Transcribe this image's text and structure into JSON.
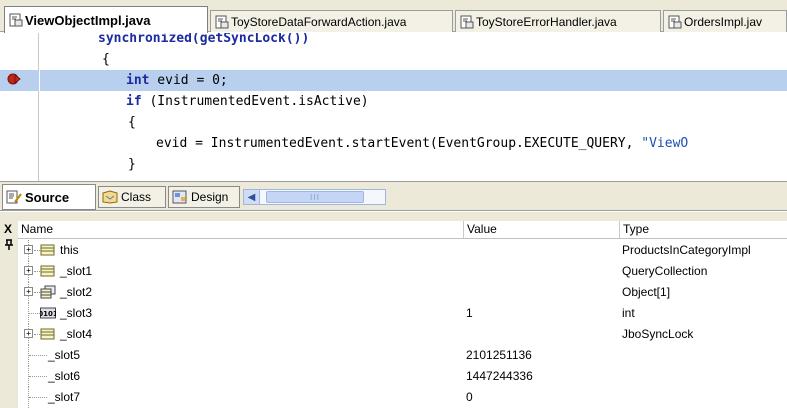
{
  "tabs": [
    {
      "label": "ViewObjectImpl.java",
      "active": true
    },
    {
      "label": "ToyStoreDataForwardAction.java",
      "active": false
    },
    {
      "label": "ToyStoreErrorHandler.java",
      "active": false
    },
    {
      "label": "OrdersImpl.jav",
      "active": false
    }
  ],
  "code": {
    "line0": "synchronized(getSyncLock())",
    "line1": "{",
    "line2_kw": "int",
    "line2_rest": " evid = 0;",
    "line3_kw": "if",
    "line3_rest": " (InstrumentedEvent.isActive)",
    "line4": "{",
    "line5_pre": "evid = InstrumentedEvent.startEvent(EventGroup.EXECUTE_QUERY, ",
    "line5_str": "\"ViewO",
    "line6": "}"
  },
  "editor_tabs": {
    "source": "Source",
    "class": "Class",
    "design": "Design",
    "scroll_thumb": "III"
  },
  "panel": {
    "close": "X",
    "pin": "†",
    "columns": {
      "name": "Name",
      "value": "Value",
      "type": "Type"
    },
    "rows": [
      {
        "name": "this",
        "value": "",
        "type": "ProductsInCategoryImpl",
        "icon": "object-icon"
      },
      {
        "name": "_slot1",
        "value": "",
        "type": "QueryCollection",
        "icon": "object-icon"
      },
      {
        "name": "_slot2",
        "value": "",
        "type": "Object[1]",
        "icon": "array-icon"
      },
      {
        "name": "_slot3",
        "value": "1",
        "type": "int",
        "icon": "primitive-icon"
      },
      {
        "name": "_slot4",
        "value": "",
        "type": "JboSyncLock",
        "icon": "object-icon"
      },
      {
        "name": "_slot5",
        "value": "2101251136",
        "type": "",
        "icon": ""
      },
      {
        "name": "_slot6",
        "value": "1447244336",
        "type": "",
        "icon": ""
      },
      {
        "name": "_slot7",
        "value": "0",
        "type": "",
        "icon": ""
      }
    ]
  },
  "colors": {
    "highlight": "#b8d0ee",
    "keyword": "#1c2ba0",
    "breakpoint": "#c0261b"
  }
}
